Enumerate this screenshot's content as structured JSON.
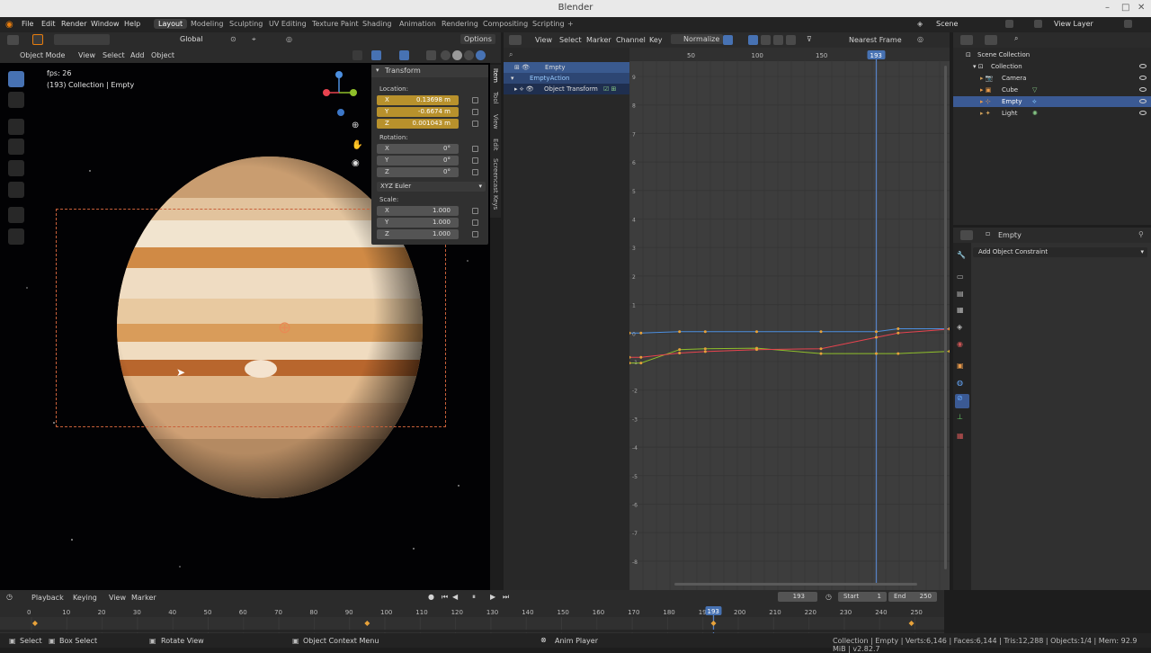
{
  "window": {
    "title": "Blender"
  },
  "menu": [
    "File",
    "Edit",
    "Render",
    "Window",
    "Help"
  ],
  "workspaces": [
    "Layout",
    "Modeling",
    "Sculpting",
    "UV Editing",
    "Texture Paint",
    "Shading",
    "Animation",
    "Rendering",
    "Compositing",
    "Scripting"
  ],
  "scene": {
    "name": "Scene",
    "view_layer": "View Layer"
  },
  "viewport": {
    "mode": "Object Mode",
    "menus": [
      "View",
      "Select",
      "Add",
      "Object"
    ],
    "orientation": "Global",
    "options": "Options",
    "fps": "fps: 26",
    "info": "(193) Collection | Empty"
  },
  "npanel": {
    "header": "Transform",
    "location_label": "Location:",
    "location": [
      {
        "axis": "X",
        "value": "0.13698 m"
      },
      {
        "axis": "Y",
        "value": "-0.6674 m"
      },
      {
        "axis": "Z",
        "value": "0.001043 m"
      }
    ],
    "rotation_label": "Rotation:",
    "rotation": [
      {
        "axis": "X",
        "value": "0°"
      },
      {
        "axis": "Y",
        "value": "0°"
      },
      {
        "axis": "Z",
        "value": "0°"
      }
    ],
    "rotation_mode": "XYZ Euler",
    "scale_label": "Scale:",
    "scale": [
      {
        "axis": "X",
        "value": "1.000"
      },
      {
        "axis": "Y",
        "value": "1.000"
      },
      {
        "axis": "Z",
        "value": "1.000"
      }
    ],
    "tabs": [
      "Item",
      "Tool",
      "View",
      "Edit",
      "Screencast Keys"
    ]
  },
  "graph": {
    "menus": [
      "View",
      "Select",
      "Marker",
      "Channel",
      "Key"
    ],
    "normalize": "Normalize",
    "pivot": "Nearest Frame",
    "channels": [
      "Empty",
      "EmptyAction",
      "Object Transform"
    ],
    "frame_ticks": [
      "50",
      "100",
      "150"
    ],
    "current_frame": "193",
    "value_ticks": [
      "9",
      "8",
      "7",
      "6",
      "5",
      "4",
      "3",
      "2",
      "1",
      "0",
      "-1",
      "-2",
      "-3",
      "-4",
      "-5",
      "-6",
      "-7",
      "-8"
    ]
  },
  "outliner": {
    "root": "Scene Collection",
    "collection": "Collection",
    "items": [
      "Camera",
      "Cube",
      "Empty",
      "Light"
    ]
  },
  "properties": {
    "object": "Empty",
    "add_constraint": "Add Object Constraint"
  },
  "timeline": {
    "menus": [
      "Playback",
      "Keying",
      "View",
      "Marker"
    ],
    "current": "193",
    "start_label": "Start",
    "start": "1",
    "end_label": "End",
    "end": "250",
    "ticks": [
      "0",
      "10",
      "20",
      "30",
      "40",
      "50",
      "60",
      "70",
      "80",
      "90",
      "100",
      "110",
      "120",
      "130",
      "140",
      "150",
      "160",
      "170",
      "180",
      "190",
      "200",
      "210",
      "220",
      "230",
      "240",
      "250"
    ],
    "playhead": "193"
  },
  "statusbar": {
    "select": "Select",
    "box_select": "Box Select",
    "rotate_view": "Rotate View",
    "context_menu": "Object Context Menu",
    "anim_player": "Anim Player",
    "stats": "Collection | Empty | Verts:6,146 | Faces:6,144 | Tris:12,288 | Objects:1/4 | Mem: 92.9 MiB | v2.82.7"
  },
  "colors": {
    "accent": "#4772b3",
    "selected_field": "#b8912c",
    "curve_x": "#e8434f",
    "curve_y": "#8fbf2a",
    "curve_z": "#4c8fe0",
    "playhead": "#5680c2"
  }
}
